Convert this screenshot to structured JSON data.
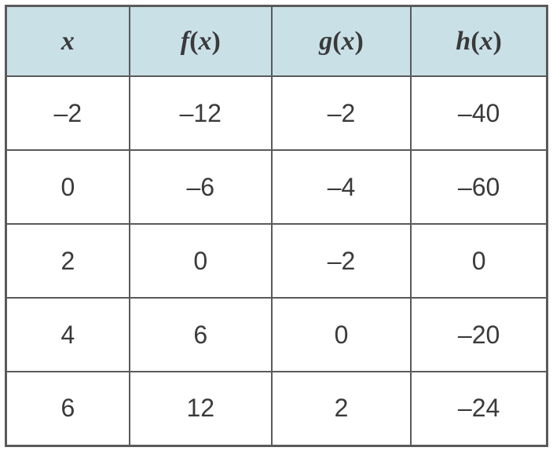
{
  "chart_data": {
    "type": "table",
    "title": "",
    "columns": [
      "x",
      "f(x)",
      "g(x)",
      "h(x)"
    ],
    "rows": [
      {
        "x": "–2",
        "f": "–12",
        "g": "–2",
        "h": "–40"
      },
      {
        "x": "0",
        "f": "–6",
        "g": "–4",
        "h": "–60"
      },
      {
        "x": "2",
        "f": "0",
        "g": "–2",
        "h": "0"
      },
      {
        "x": "4",
        "f": "6",
        "g": "0",
        "h": "–20"
      },
      {
        "x": "6",
        "f": "12",
        "g": "2",
        "h": "–24"
      }
    ]
  },
  "headers": {
    "x": "x",
    "f_name": "f",
    "g_name": "g",
    "h_name": "h",
    "arg": "x"
  }
}
